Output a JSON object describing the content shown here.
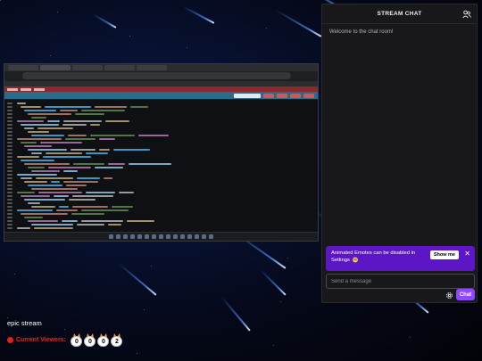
{
  "chat": {
    "title": "STREAM CHAT",
    "users_icon": "users-icon",
    "welcome": "Welcome to the chat room!",
    "notice": {
      "text": "Animated Emotes can be disabled in Settings",
      "show_label": "Show me",
      "close_icon": "close-icon"
    },
    "input_placeholder": "Send a message",
    "settings_icon": "gear-icon",
    "send_label": "Chat",
    "accent": "#9147ff"
  },
  "stream": {
    "title": "epic stream",
    "viewers_label": "Current Viewers:",
    "viewer_digits": [
      "0",
      "0",
      "0",
      "2"
    ]
  },
  "colors": {
    "live_dot": "#e0211f",
    "notice_bg": "#5c16c5"
  }
}
